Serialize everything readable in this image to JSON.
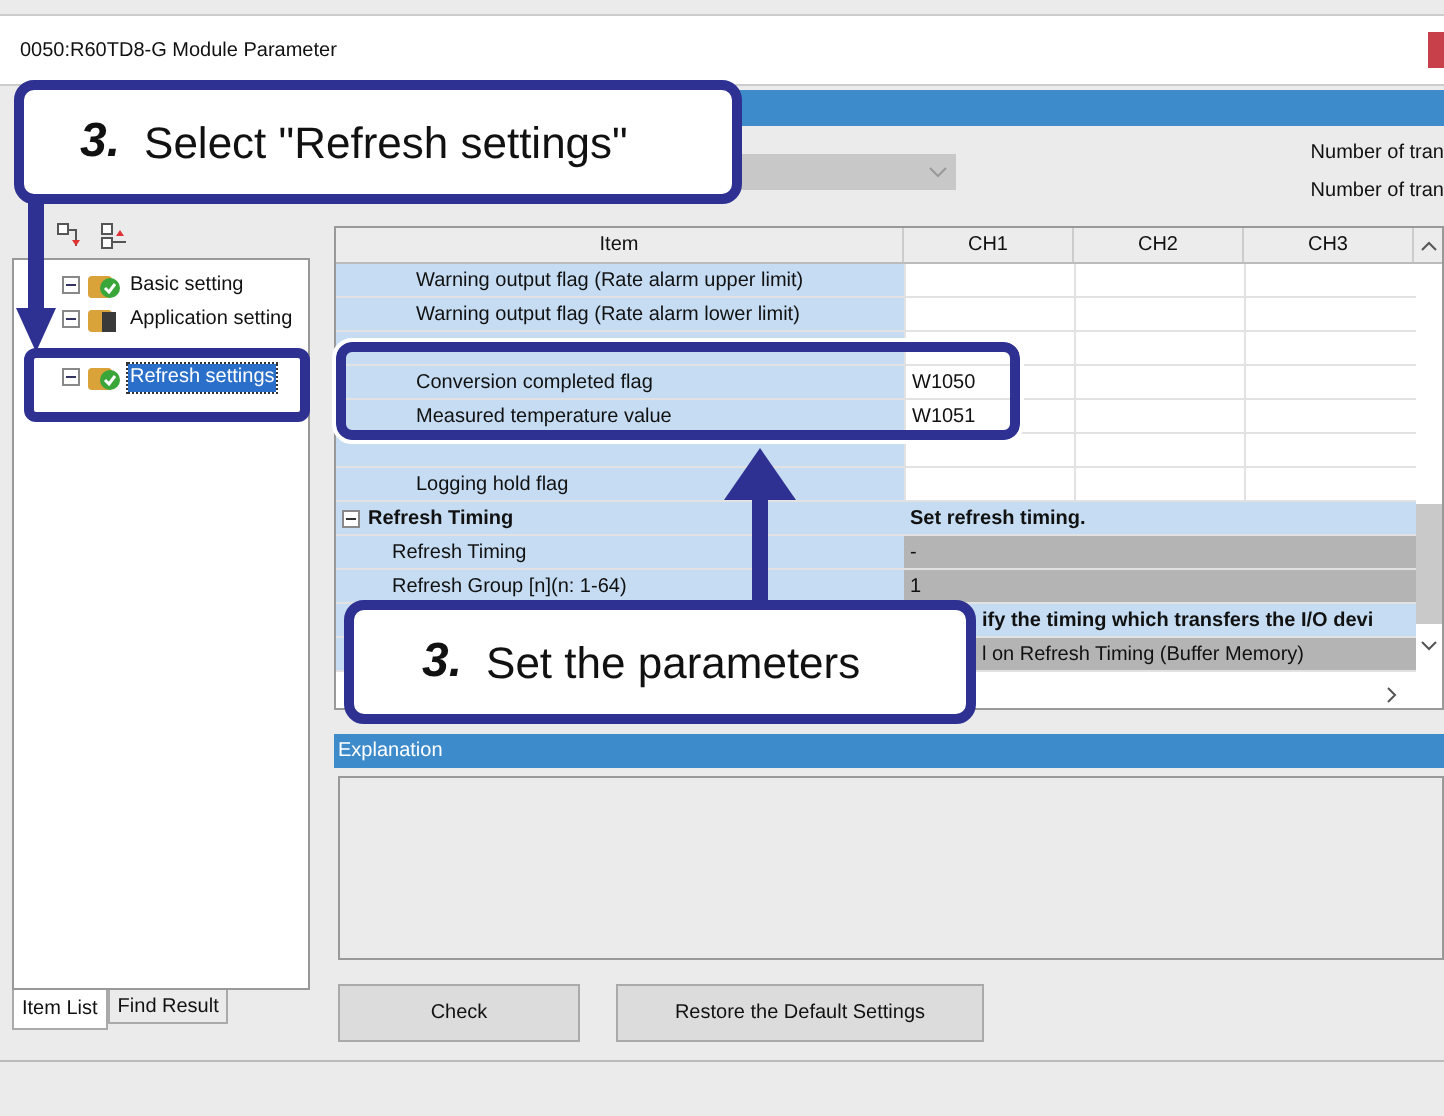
{
  "window": {
    "title": "0050:R60TD8-G Module Parameter"
  },
  "top_panel": {
    "dropdown": {
      "disabled": true
    },
    "labels": [
      "Number of tran",
      "Number of tran"
    ]
  },
  "tree": {
    "items": [
      {
        "label": "Basic setting",
        "kind": "checked",
        "selected": false
      },
      {
        "label": "Application setting",
        "kind": "module",
        "selected": false
      },
      {
        "label": "Refresh settings",
        "kind": "checked",
        "selected": true
      }
    ]
  },
  "tabs": [
    {
      "label": "Item List",
      "selected": true
    },
    {
      "label": "Find Result",
      "selected": false
    }
  ],
  "table": {
    "columns": [
      "Item",
      "CH1",
      "CH2",
      "CH3"
    ],
    "rows": [
      {
        "kind": "item",
        "label": "Warning output flag (Rate alarm upper limit)",
        "values": []
      },
      {
        "kind": "item",
        "label": "Warning output flag (Rate alarm lower limit)",
        "values": []
      },
      {
        "kind": "item",
        "values": []
      },
      {
        "kind": "item",
        "label": "Conversion completed flag",
        "values": [
          "W1050"
        ]
      },
      {
        "kind": "item",
        "label": "Measured temperature value",
        "values": [
          "W1051"
        ]
      },
      {
        "kind": "item",
        "values": []
      },
      {
        "kind": "item",
        "label": "Logging hold flag",
        "values": []
      },
      {
        "kind": "group",
        "label": "Refresh Timing",
        "expanded": true,
        "setting": "Set refresh timing."
      },
      {
        "kind": "span",
        "label": "Refresh Timing",
        "fixed": true,
        "setting": "-"
      },
      {
        "kind": "span",
        "label": "Refresh Group [n](n: 1-64)",
        "fixed": true,
        "setting": "1"
      },
      {
        "kind": "group",
        "setting": "ify the timing which transfers the I/O devi"
      },
      {
        "kind": "span",
        "fixed": true,
        "setting": "l on Refresh Timing (Buffer Memory)"
      }
    ]
  },
  "explanation": {
    "title": "Explanation"
  },
  "buttons": [
    "Check",
    "Restore the Default Settings"
  ],
  "callouts": [
    {
      "step": "3.",
      "text": "Select \"Refresh settings\""
    },
    {
      "step": "3.",
      "text": "Set the parameters"
    }
  ]
}
